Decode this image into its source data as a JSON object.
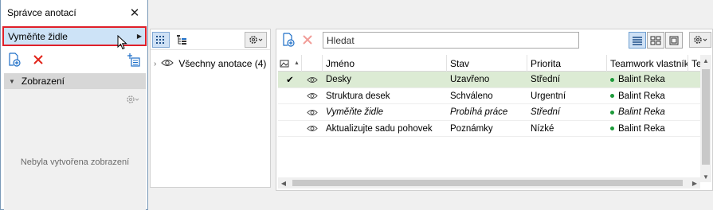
{
  "palette": {
    "accent_blue": "#1e6fc7",
    "delete_red": "#e1251b",
    "selected_row": "#dcebd4",
    "dropdown_highlight": "#cde3f7",
    "dropdown_border": "#e0202a",
    "owner_dot": "#1d9a3a"
  },
  "left_panel": {
    "title": "Správce anotací",
    "close_icon": "close-icon",
    "dropdown_label": "Vyměňte židle",
    "dropdown_icon": "chevron-right-icon",
    "section_label": "Zobrazení",
    "section_icon": "chevron-down-icon",
    "empty_text": "Nebyla vytvořena zobrazení"
  },
  "tree": {
    "root_label": "Všechny anotace (4)",
    "root_icon": "eye-icon"
  },
  "toolbar": {
    "search_placeholder": "Hledat"
  },
  "table": {
    "columns": [
      "",
      "",
      "Jméno",
      "Stav",
      "Priorita",
      "Teamwork vlastník",
      "Ter"
    ],
    "rows": [
      {
        "check": "✔",
        "name": "Desky",
        "status": "Uzavřeno",
        "priority": "Střední",
        "owner": "Balint Reka",
        "italic": false,
        "selected": true
      },
      {
        "check": "",
        "name": "Struktura desek",
        "status": "Schváleno",
        "priority": "Urgentní",
        "owner": "Balint Reka",
        "italic": false,
        "selected": false
      },
      {
        "check": "",
        "name": "Vyměňte židle",
        "status": "Probíhá práce",
        "priority": "Střední",
        "owner": "Balint Reka",
        "italic": true,
        "selected": false
      },
      {
        "check": "",
        "name": "Aktualizujte sadu pohovek",
        "status": "Poznámky",
        "priority": "Nízké",
        "owner": "Balint Reka",
        "italic": false,
        "selected": false
      }
    ]
  }
}
